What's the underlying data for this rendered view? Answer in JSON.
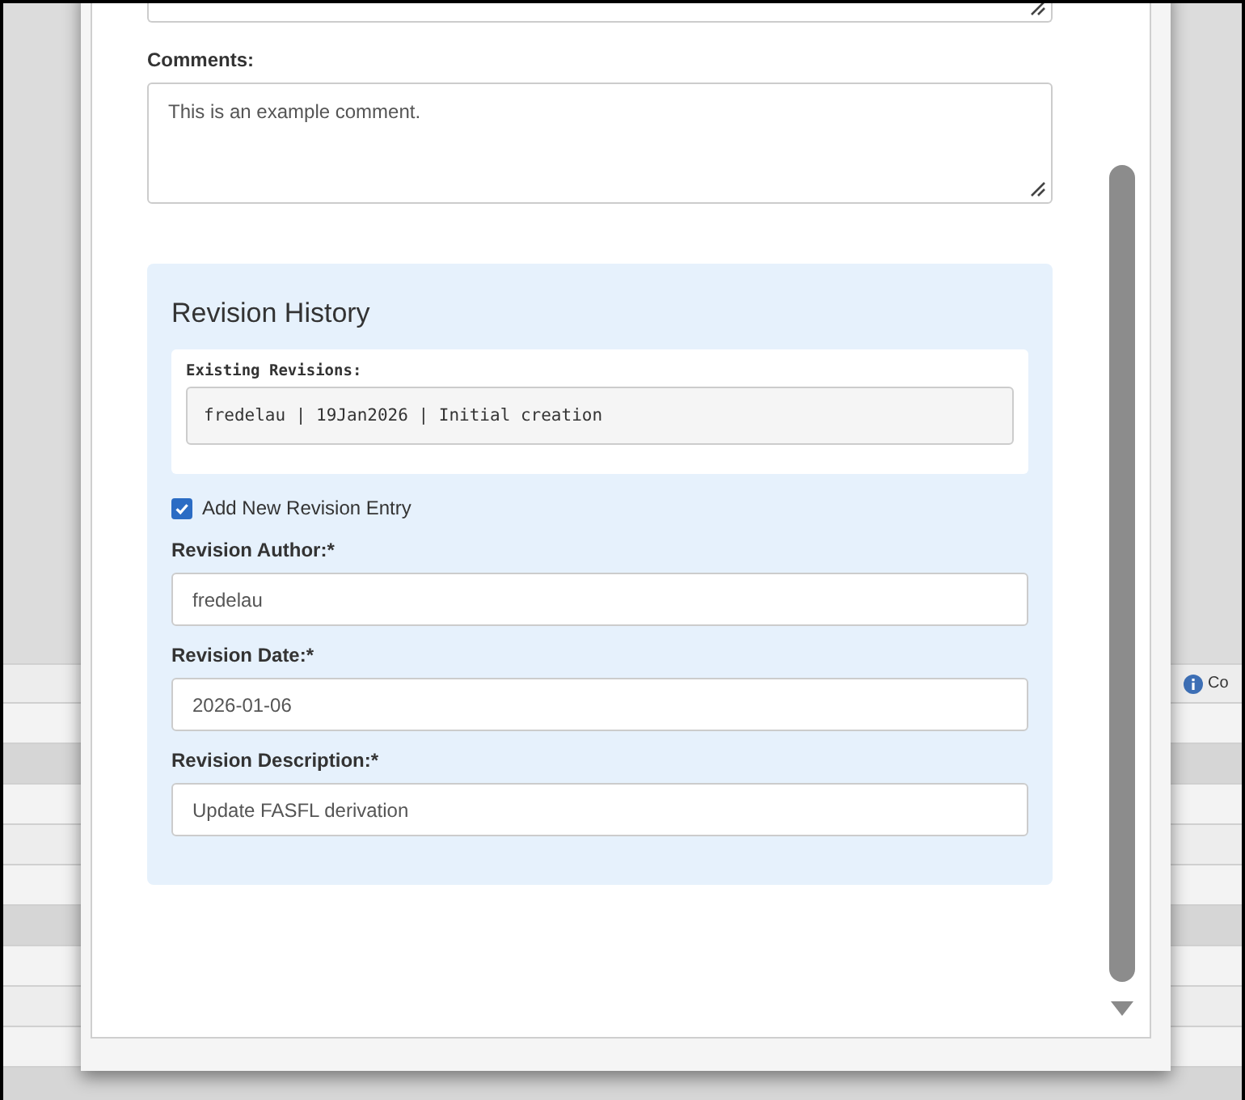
{
  "background": {
    "status_text": "Co"
  },
  "form": {
    "comments": {
      "label": "Comments:",
      "value": "This is an example comment."
    },
    "revision_history": {
      "title": "Revision History",
      "existing_label": "Existing Revisions:",
      "existing_entries": [
        "fredelau | 19Jan2026 | Initial creation"
      ],
      "add_new": {
        "label": "Add New Revision Entry",
        "checked": true
      },
      "fields": [
        {
          "label": "Revision Author:*",
          "value": "fredelau"
        },
        {
          "label": "Revision Date:*",
          "value": "2026-01-06"
        },
        {
          "label": "Revision Description:*",
          "value": "Update FASFL derivation"
        }
      ]
    }
  }
}
